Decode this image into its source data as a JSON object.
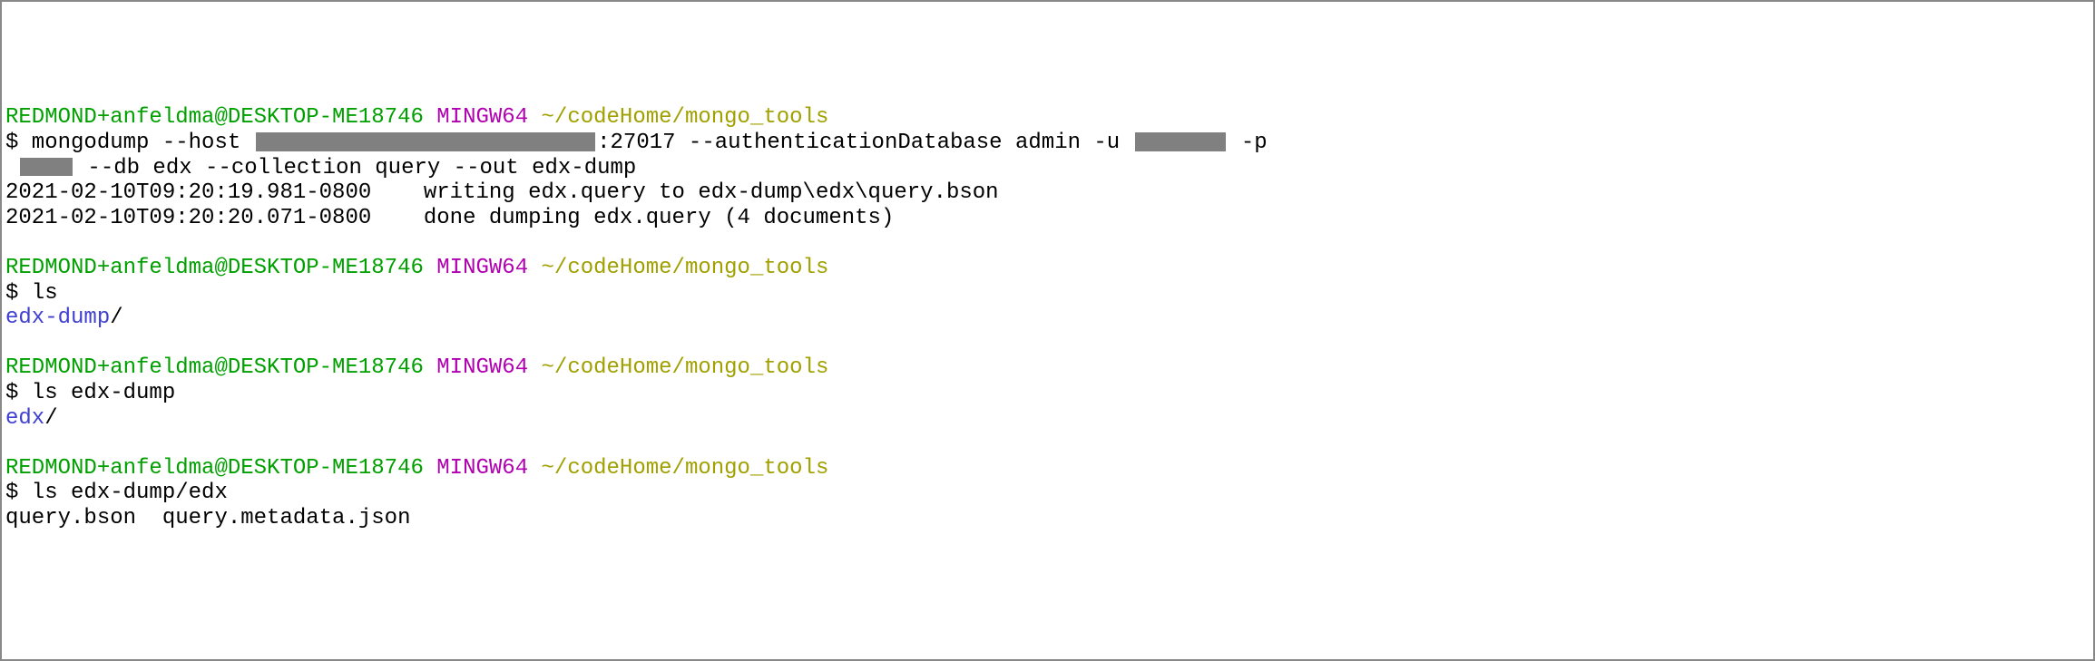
{
  "block1": {
    "prompt": {
      "userhost": "REDMOND+anfeldma@DESKTOP-ME18746",
      "shell": "MINGW64",
      "path": "~/codeHome/mongo_tools"
    },
    "cmd_line1_a": "$ mongodump --host ",
    "cmd_line1_b": ":27017 --authenticationDatabase admin -u ",
    "cmd_line1_c": " -p",
    "cmd_line2_a": " ",
    "cmd_line2_b": " --db edx --collection query --out edx-dump",
    "out1": "2021-02-10T09:20:19.981-0800    writing edx.query to edx-dump\\edx\\query.bson",
    "out2": "2021-02-10T09:20:20.071-0800    done dumping edx.query (4 documents)"
  },
  "block2": {
    "prompt": {
      "userhost": "REDMOND+anfeldma@DESKTOP-ME18746",
      "shell": "MINGW64",
      "path": "~/codeHome/mongo_tools"
    },
    "cmd": "$ ls",
    "out_dir": "edx-dump",
    "out_slash": "/"
  },
  "block3": {
    "prompt": {
      "userhost": "REDMOND+anfeldma@DESKTOP-ME18746",
      "shell": "MINGW64",
      "path": "~/codeHome/mongo_tools"
    },
    "cmd": "$ ls edx-dump",
    "out_dir": "edx",
    "out_slash": "/"
  },
  "block4": {
    "prompt": {
      "userhost": "REDMOND+anfeldma@DESKTOP-ME18746",
      "shell": "MINGW64",
      "path": "~/codeHome/mongo_tools"
    },
    "cmd": "$ ls edx-dump/edx",
    "out": "query.bson  query.metadata.json"
  }
}
